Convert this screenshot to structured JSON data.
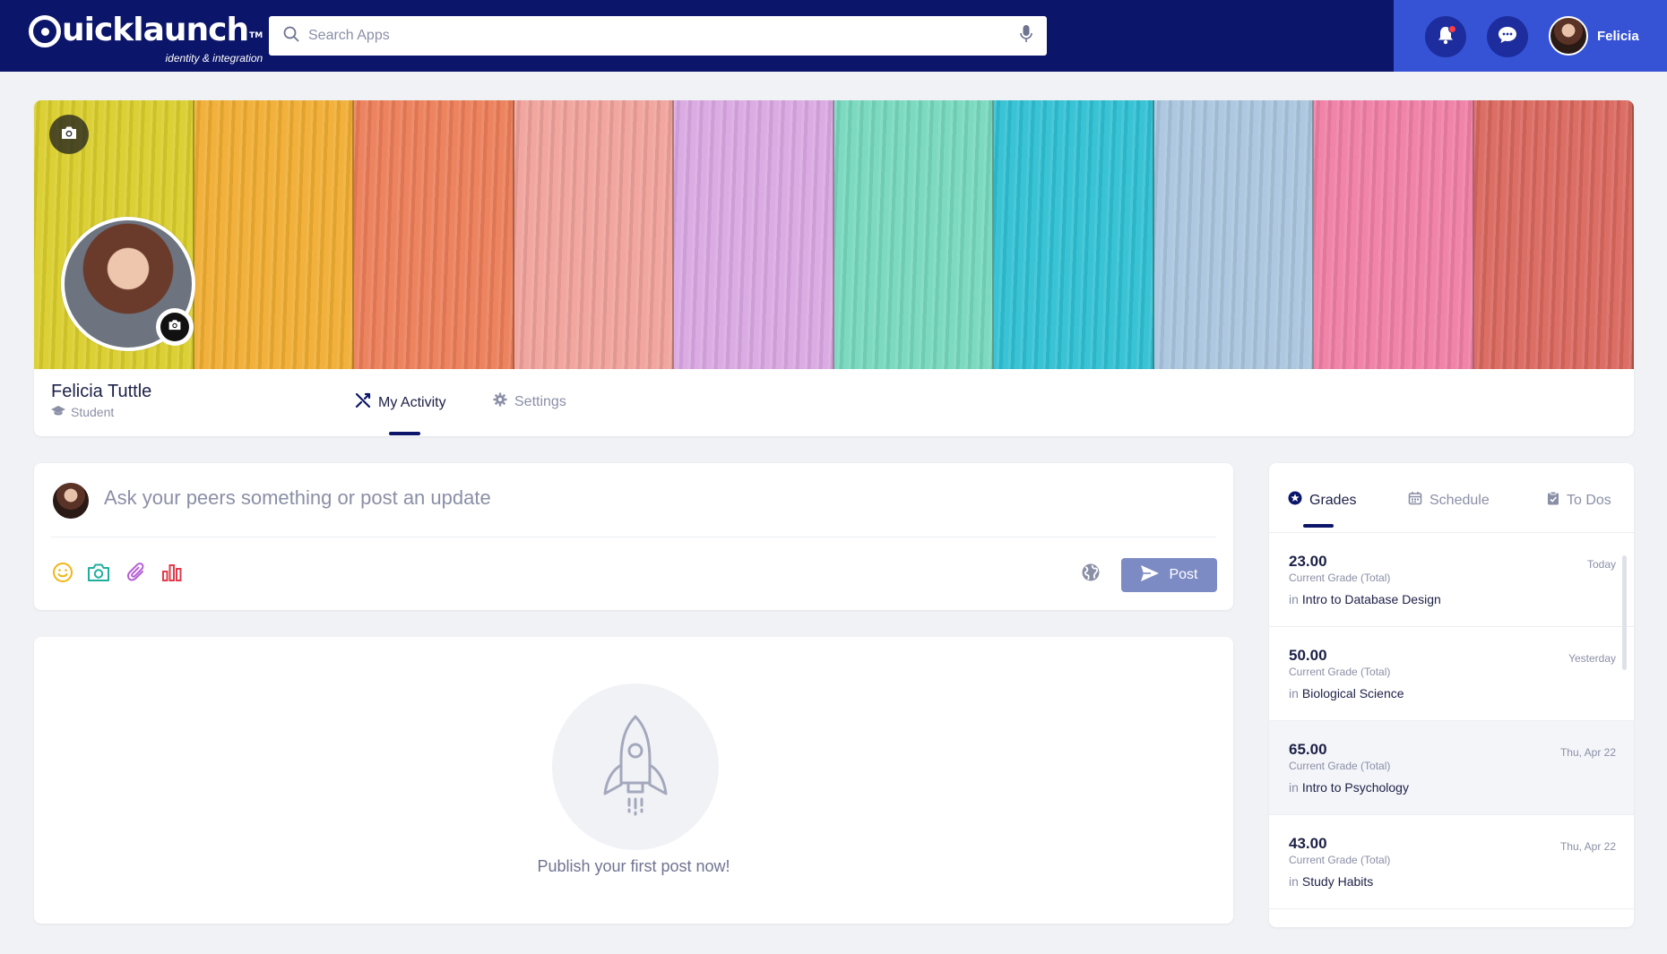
{
  "header": {
    "logo_text": "uicklaunch",
    "logo_tm": "TM",
    "logo_tagline": "identity & integration",
    "search_placeholder": "Search Apps",
    "user_name": "Felicia",
    "colors": {
      "primary": "#0b1569",
      "accent": "#3653d6"
    }
  },
  "profile": {
    "name": "Felicia Tuttle",
    "role": "Student",
    "cover_colors": [
      "#d9cd2a",
      "#f0ad31",
      "#ec7d58",
      "#f0a29b",
      "#d9a8e2",
      "#76d8bd",
      "#2fc0d3",
      "#a9c5de",
      "#ef7ea4",
      "#d9675e"
    ],
    "tabs": [
      {
        "label": "My Activity",
        "icon": "activity-icon",
        "active": true
      },
      {
        "label": "Settings",
        "icon": "gear-icon",
        "active": false
      }
    ]
  },
  "composer": {
    "placeholder": "Ask your peers something or post an update",
    "tools": [
      "emoji-icon",
      "camera-icon",
      "paperclip-icon",
      "bar-chart-icon"
    ],
    "post_label": "Post"
  },
  "feed": {
    "empty_message": "Publish your first post now!"
  },
  "sidebar": {
    "tabs": [
      {
        "label": "Grades",
        "icon": "star-icon",
        "active": true
      },
      {
        "label": "Schedule",
        "icon": "calendar-icon",
        "active": false
      },
      {
        "label": "To Dos",
        "icon": "clipboard-icon",
        "active": false
      }
    ],
    "grade_label": "Current Grade (Total)",
    "in_label": "in",
    "grades": [
      {
        "value": "23.00",
        "course": "Intro to Database Design",
        "date": "Today"
      },
      {
        "value": "50.00",
        "course": "Biological Science",
        "date": "Yesterday"
      },
      {
        "value": "65.00",
        "course": "Intro to Psychology",
        "date": "Thu, Apr 22"
      },
      {
        "value": "43.00",
        "course": "Study Habits",
        "date": "Thu, Apr 22"
      }
    ]
  }
}
